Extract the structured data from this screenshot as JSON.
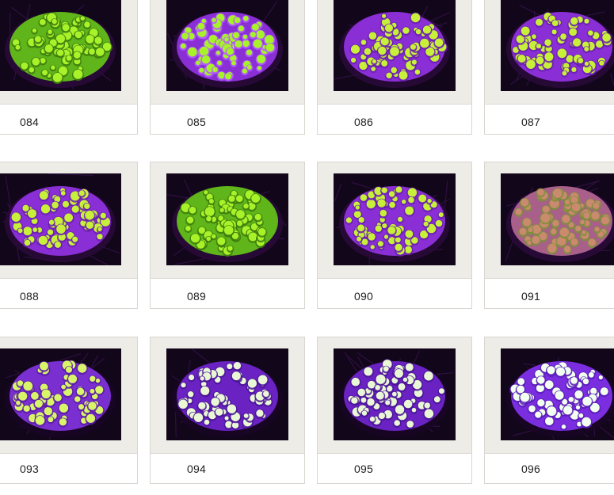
{
  "gallery": {
    "items": [
      {
        "code": "084",
        "colony": "green"
      },
      {
        "code": "085",
        "colony": "green-purple"
      },
      {
        "code": "086",
        "colony": "purple-yellow"
      },
      {
        "code": "087",
        "colony": "purple-yellow"
      },
      {
        "code": "088",
        "colony": "purple-yellow"
      },
      {
        "code": "089",
        "colony": "green"
      },
      {
        "code": "090",
        "colony": "purple-yellow"
      },
      {
        "code": "091",
        "colony": "tan-pink"
      },
      {
        "code": "093",
        "colony": "purple-yellow-tips"
      },
      {
        "code": "094",
        "colony": "purple-white-tips"
      },
      {
        "code": "095",
        "colony": "purple-white-tips"
      },
      {
        "code": "096",
        "colony": "purple-white-dots"
      }
    ]
  },
  "colors": {
    "frame": "#eeece7",
    "border": "#d9d6d1",
    "tank_bg": "#12061a",
    "green": "#a8f22a",
    "purple": "#8a2fd6",
    "pink_tan": "#c98a6e",
    "white_tip": "#eaf7d6"
  }
}
